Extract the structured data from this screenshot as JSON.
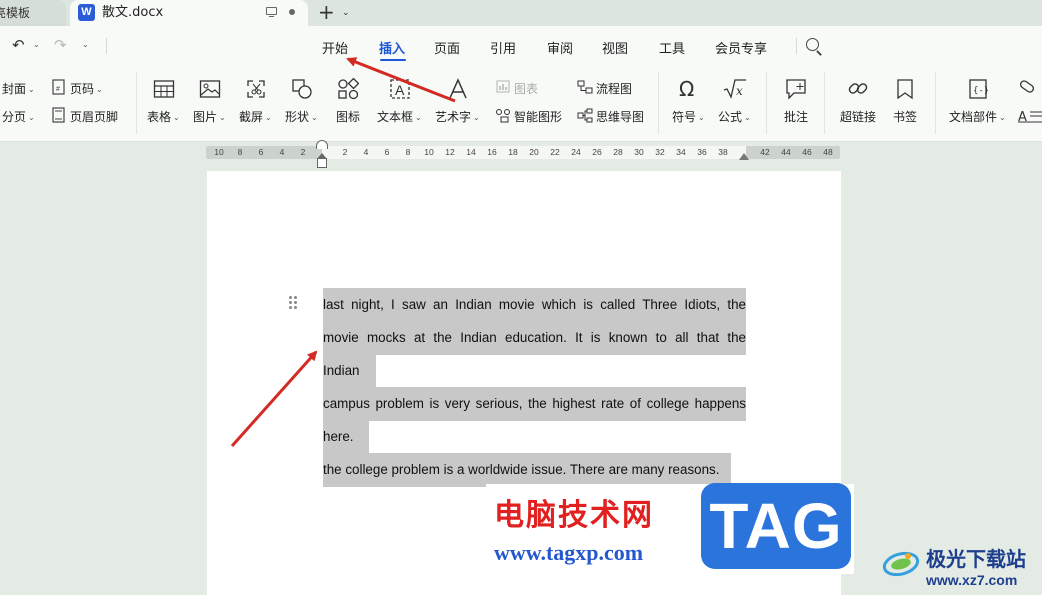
{
  "tabs": {
    "prev_label": "亮模板",
    "active_label": "散文.docx",
    "app_icon_letter": "W",
    "new_tab": "+",
    "new_tab_caret": "⌄"
  },
  "quick_access": {
    "undo": "↶",
    "redo": "↷",
    "more": "⌄"
  },
  "menu": {
    "tabs": [
      "开始",
      "插入",
      "页面",
      "引用",
      "审阅",
      "视图",
      "工具",
      "会员专享"
    ],
    "active": "插入"
  },
  "ribbon": {
    "cover": "封面",
    "page_number": "页码",
    "page_break": "分页",
    "header_footer": "页眉页脚",
    "table": "表格",
    "picture": "图片",
    "screenshot": "截屏",
    "shape": "形状",
    "icon": "图标",
    "textbox": "文本框",
    "wordart": "艺术字",
    "chart": "图表",
    "smartart": "智能图形",
    "flowchart": "流程图",
    "mindmap": "思维导图",
    "symbol": "符号",
    "formula": "公式",
    "comment": "批注",
    "hyperlink": "超链接",
    "bookmark": "书签",
    "doc_parts": "文档部件",
    "caret": "⌄"
  },
  "ruler": {
    "ticks": [
      "10",
      "8",
      "6",
      "4",
      "2",
      "2",
      "4",
      "6",
      "8",
      "10",
      "12",
      "14",
      "16",
      "18",
      "20",
      "22",
      "24",
      "26",
      "28",
      "30",
      "32",
      "34",
      "36",
      "38",
      "42",
      "44",
      "46",
      "48"
    ]
  },
  "document": {
    "lines": [
      "last night, I saw an Indian movie which is called Three Idiots, the",
      "movie mocks at the Indian education. It is known to all that the",
      "Indian",
      "campus problem is very serious, the highest rate of college happens",
      "here.",
      "the college problem is a worldwide issue. There are many reasons."
    ]
  },
  "watermarks": {
    "site_cn": "电脑技术网",
    "site_url": "www.tagxp.com",
    "tag": "TAG",
    "site2_cn": "极光下载站",
    "site2_url": "www.xz7.com"
  },
  "colors": {
    "accent": "#1d56d9",
    "arrow": "#d42a24",
    "selection": "#c8c8c8",
    "wm_red": "#e1201f",
    "wm_blue": "#2a74dc"
  }
}
